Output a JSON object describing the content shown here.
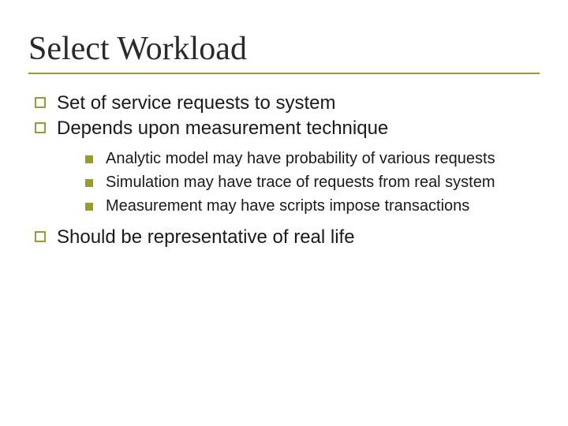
{
  "title": "Select Workload",
  "bullets": [
    {
      "text": "Set of service requests to system"
    },
    {
      "text": "Depends upon measurement technique",
      "sub": [
        "Analytic model may have probability of various requests",
        "Simulation may have trace of requests from real system",
        "Measurement may have scripts impose transactions"
      ]
    },
    {
      "text": "Should be representative of real life"
    }
  ]
}
